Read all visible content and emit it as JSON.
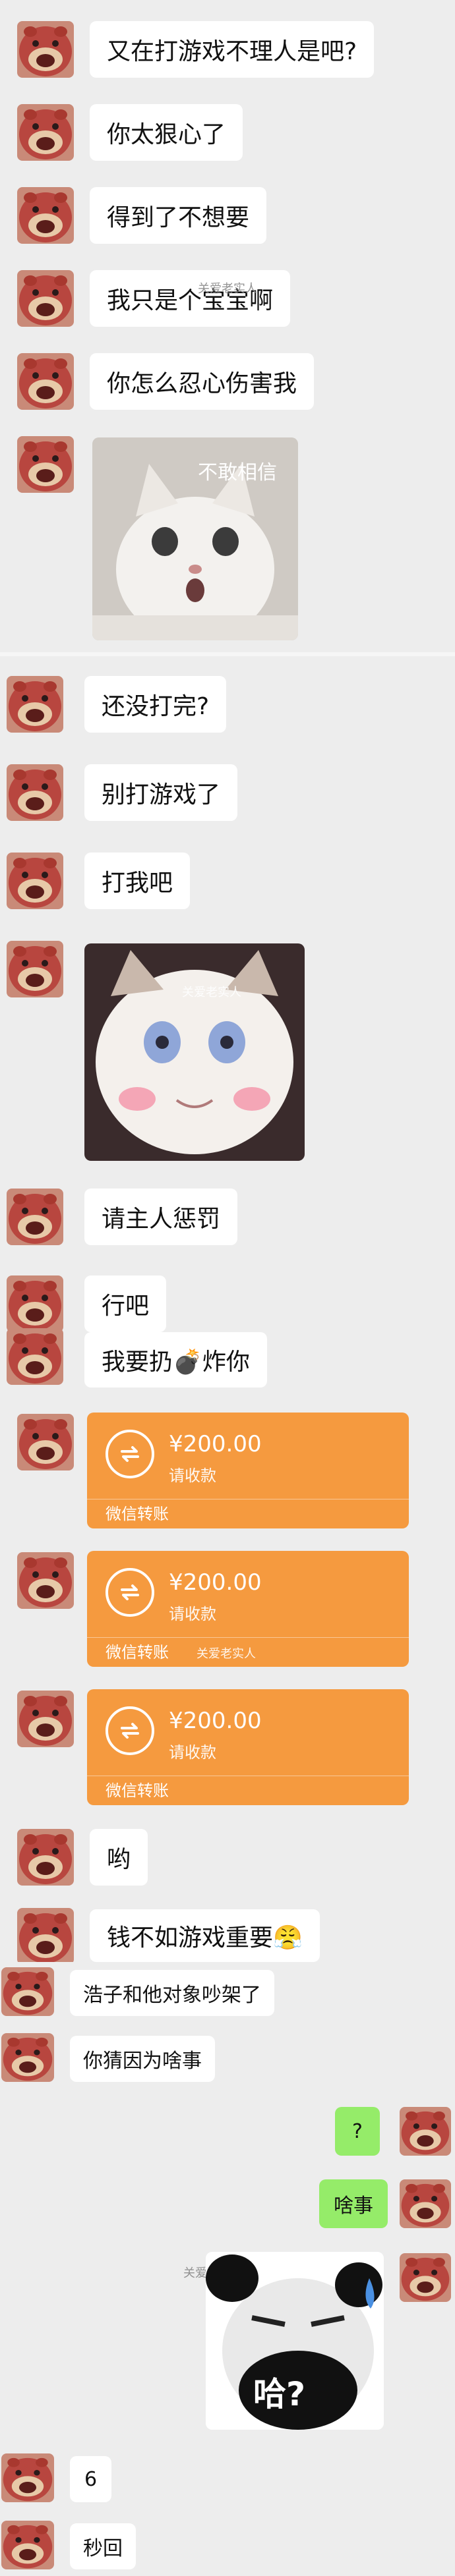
{
  "messages": {
    "m1": "又在打游戏不理人是吧?",
    "m2": "你太狠心了",
    "m3": "得到了不想要",
    "m4": "我只是个宝宝啊",
    "m5": "你怎么忍心伤害我",
    "m6": "还没打完?",
    "m7": "别打游戏了",
    "m8": "打我吧",
    "m9": "请主人惩罚",
    "m10": "行吧",
    "m11": "我要扔💣炸你",
    "m12": "哟",
    "m13": "钱不如游戏重要😤",
    "m14": "浩子和他对象吵架了",
    "m15": "你猜因为啥事",
    "m16": "?",
    "m17": "啥事",
    "m18": "6",
    "m19": "秒回"
  },
  "images": {
    "cat1_caption": "不敢相信",
    "meme_caption": "哈?",
    "watermark": "关爱老实人"
  },
  "transfers": [
    {
      "amount": "¥200.00",
      "status": "请收款",
      "label": "微信转账"
    },
    {
      "amount": "¥200.00",
      "status": "请收款",
      "label": "微信转账"
    },
    {
      "amount": "¥200.00",
      "status": "请收款",
      "label": "微信转账"
    }
  ],
  "colors": {
    "background": "#ededed",
    "bubble_left": "#ffffff",
    "bubble_right": "#95ec69",
    "transfer": "#f59a3f"
  },
  "icons": {
    "avatar": "red-plush-toy-avatar",
    "transfer": "transfer-arrows-icon"
  }
}
